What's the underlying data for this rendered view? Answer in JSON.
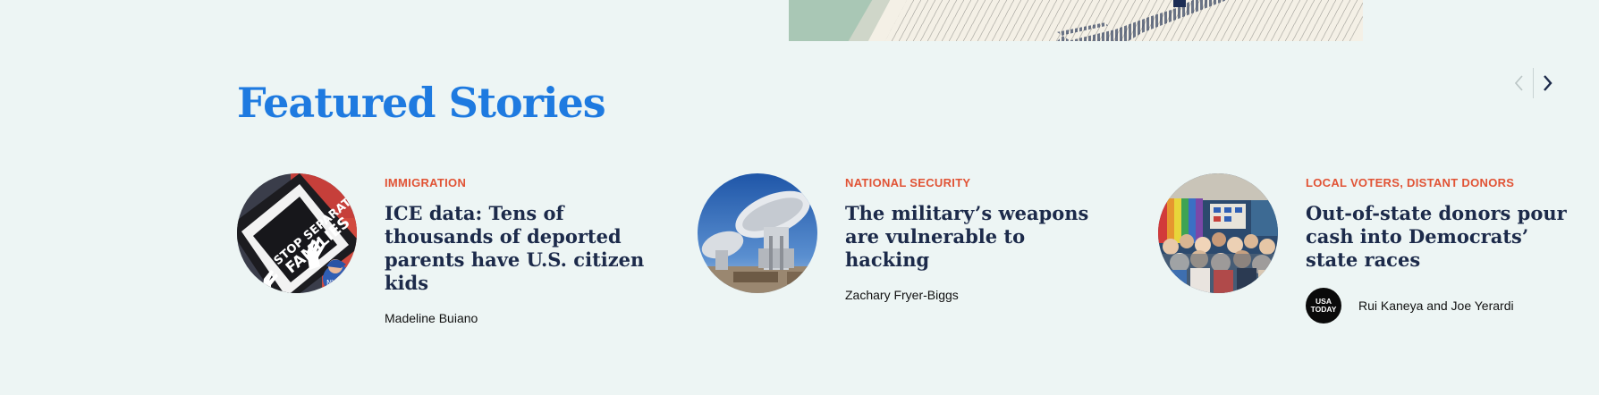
{
  "section": {
    "title": "Featured Stories"
  },
  "carousel": {
    "prev_icon": "chevron-left-icon",
    "next_icon": "chevron-right-icon"
  },
  "stories": [
    {
      "category": "IMMIGRATION",
      "headline": "ICE data: Tens of thousands of deported parents have U.S. citizen kids",
      "authors": [
        "Madeline Buiano"
      ]
    },
    {
      "category": "NATIONAL SECURITY",
      "headline": "The military’s weapons are vulnerable to hacking",
      "authors": [
        "Zachary Fryer-Biggs"
      ]
    },
    {
      "category": "LOCAL VOTERS, DISTANT DONORS",
      "headline": "Out-of-state donors pour cash into Democrats’ state races",
      "authors": [
        "Rui Kaneya",
        "Joe Yerardi"
      ],
      "author_joiner": "and",
      "partner_logo": [
        "USA",
        "TODAY"
      ]
    }
  ],
  "colors": {
    "background": "#edf5f4",
    "title_blue": "#1e7ae0",
    "category_red": "#e15335",
    "headline_navy": "#1c2a4a"
  }
}
